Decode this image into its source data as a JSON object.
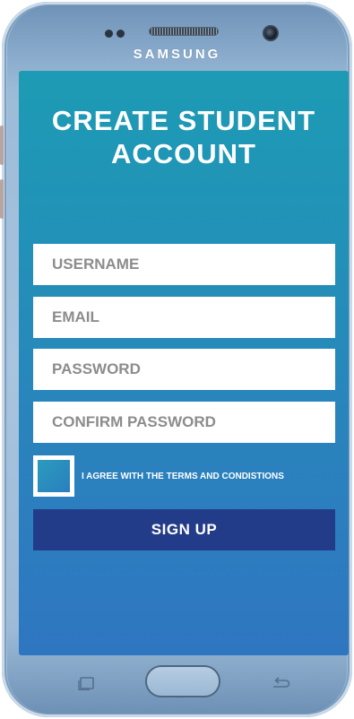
{
  "device": {
    "brand": "SAMSUNG"
  },
  "screen": {
    "title": "CREATE STUDENT ACCOUNT",
    "fields": {
      "username_placeholder": "USERNAME",
      "email_placeholder": "EMAIL",
      "password_placeholder": "PASSWORD",
      "confirm_password_placeholder": "CONFIRM PASSWORD"
    },
    "terms": {
      "label": "I AGREE WITH THE TERMS AND CONDISTIONS",
      "checked": false
    },
    "signup_label": "SIGN UP"
  },
  "colors": {
    "screen_top": "#1d9bb4",
    "screen_bottom": "#2f76c1",
    "button": "#233c8a",
    "field_bg": "#ffffff",
    "placeholder_text": "#8c8c8c"
  },
  "icons": {
    "left_nav": "recent-apps-icon",
    "right_nav": "back-icon"
  }
}
